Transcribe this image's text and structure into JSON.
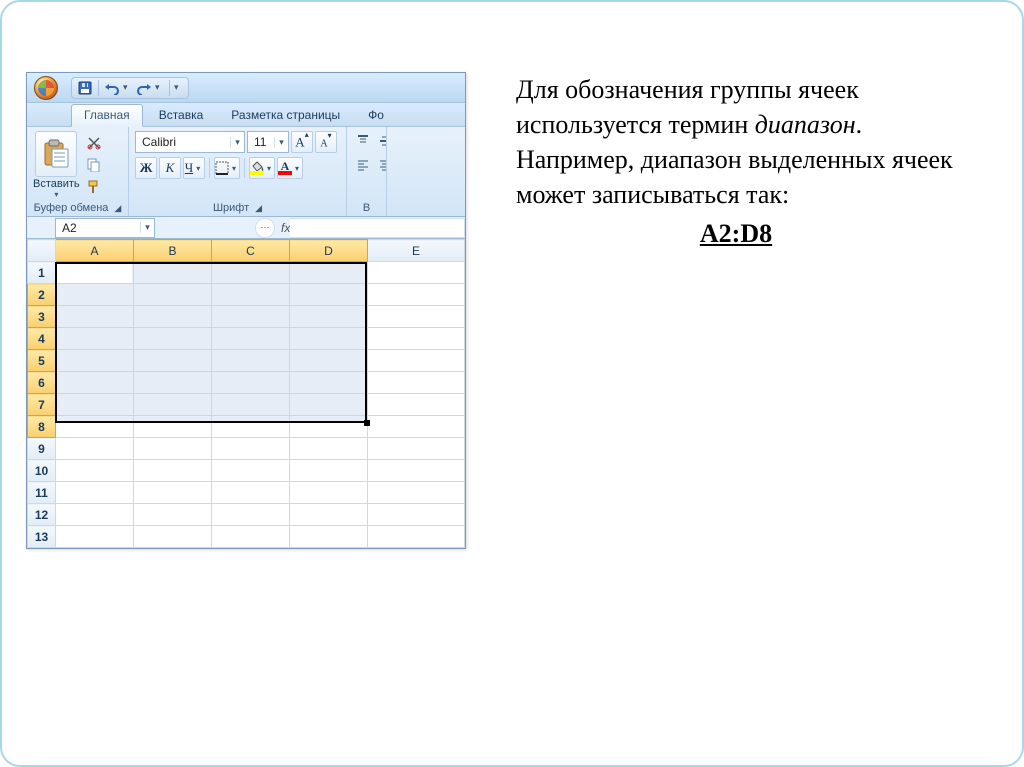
{
  "titlebar": {
    "office_tooltip": "Office"
  },
  "qat": {
    "save": "save",
    "undo": "undo",
    "redo": "redo",
    "menu": "▾"
  },
  "ribbon": {
    "tabs": [
      "Главная",
      "Вставка",
      "Разметка страницы",
      "Фо"
    ],
    "active_index": 0,
    "clipboard": {
      "paste": "Вставить",
      "group_label": "Буфер обмена"
    },
    "font": {
      "name": "Calibri",
      "size": "11",
      "bold": "Ж",
      "italic": "К",
      "underline": "Ч",
      "group_label": "Шрифт"
    },
    "align": {
      "group_label": "В"
    }
  },
  "formula": {
    "namebox": "A2",
    "fx": "fx"
  },
  "grid": {
    "cols": [
      "A",
      "B",
      "C",
      "D",
      "E"
    ],
    "rows": [
      "1",
      "2",
      "3",
      "4",
      "5",
      "6",
      "7",
      "8",
      "9",
      "10",
      "11",
      "12",
      "13"
    ],
    "sel_cols": [
      0,
      1,
      2,
      3
    ],
    "sel_rows": [
      1,
      2,
      3,
      4,
      5,
      6,
      7
    ],
    "active_cell": "A2",
    "selection_label": "A2:D8"
  },
  "explain": {
    "p1a": "Для обозначения группы ячеек используется термин ",
    "term": "диапазон",
    "p1b": ". Например, диапазон выделенных ячеек может записываться так:",
    "answer": "A2:D8"
  },
  "colors": {
    "fill_swatch": "#ffff00",
    "font_swatch": "#ff0000"
  }
}
